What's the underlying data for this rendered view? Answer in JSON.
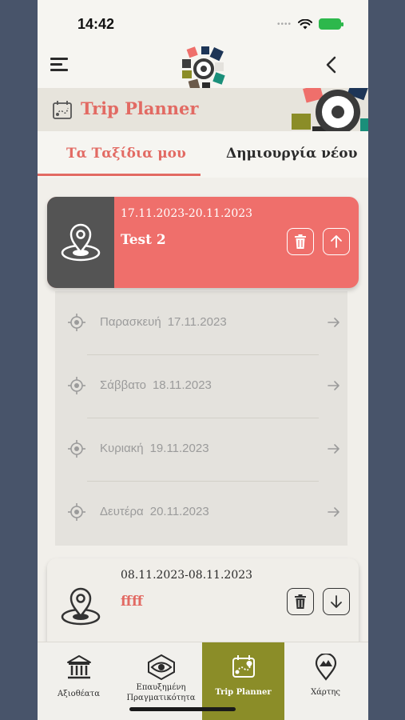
{
  "status": {
    "time": "14:42"
  },
  "header": {
    "title": "Trip Planner"
  },
  "tabs": [
    {
      "label": "Τα Ταξίδια μου",
      "active": true
    },
    {
      "label": "Δημιουργία νέου",
      "active": false
    }
  ],
  "trips": [
    {
      "dates": "17.11.2023-20.11.2023",
      "name": "Test 2",
      "expanded": true,
      "days": [
        {
          "weekday": "Παρασκευή",
          "date": "17.11.2023"
        },
        {
          "weekday": "Σάββατο",
          "date": "18.11.2023"
        },
        {
          "weekday": "Κυριακή",
          "date": "19.11.2023"
        },
        {
          "weekday": "Δευτέρα",
          "date": "20.11.2023"
        }
      ]
    },
    {
      "dates": "08.11.2023-08.11.2023",
      "name": "ffff",
      "expanded": false
    }
  ],
  "bottom_nav": [
    {
      "label": "Αξιοθέατα",
      "icon": "museum-icon",
      "active": false
    },
    {
      "label": "Επαυξημένη Πραγματικότητα",
      "icon": "ar-eye-icon",
      "active": false
    },
    {
      "label": "Trip Planner",
      "icon": "trip-planner-icon",
      "active": true
    },
    {
      "label": "Χάρτης",
      "icon": "map-pin-icon",
      "active": false
    }
  ],
  "colors": {
    "accent": "#e26a63",
    "active_nav": "#8b8d28",
    "dark_card": "#545454"
  }
}
